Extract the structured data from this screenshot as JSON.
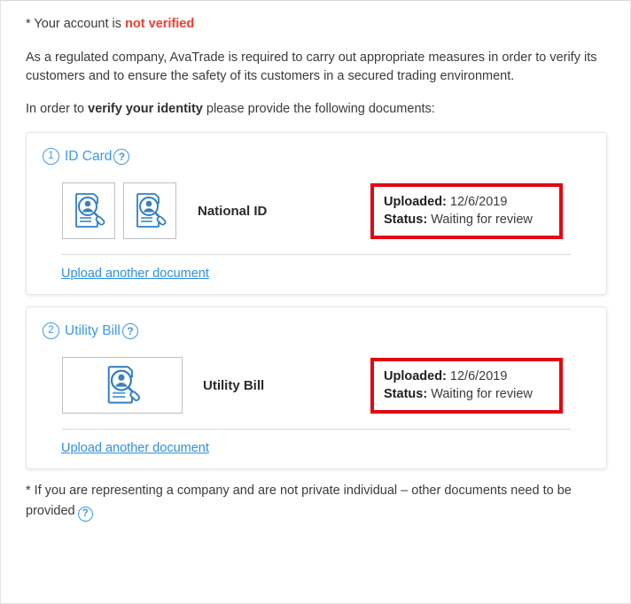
{
  "notice": {
    "prefix": "* Your account is ",
    "status_text": "not verified",
    "status_color": "#ef3e33"
  },
  "description": "As a regulated company, AvaTrade is required to carry out appropriate measures in order to verify its customers and to ensure the safety of its customers in a secured trading environment.",
  "instruction": {
    "before": "In order to ",
    "emphasis": "verify your identity",
    "after": " please provide the following documents:"
  },
  "sections": [
    {
      "number": "1",
      "title": "ID Card",
      "help_icon": "question-mark-icon",
      "help_label": "?",
      "document_label": "National ID",
      "thumbnail_count": 2,
      "thumbnail_style": "square",
      "thumbnail_icon": "id-document-magnifier-icon",
      "status": {
        "uploaded_key": "Uploaded:",
        "uploaded_value": "12/6/2019",
        "status_key": "Status:",
        "status_value": "Waiting for review",
        "highlight_color": "#e30613"
      },
      "upload_link": "Upload another document"
    },
    {
      "number": "2",
      "title": "Utility Bill",
      "help_icon": "question-mark-icon",
      "help_label": "?",
      "document_label": "Utility Bill",
      "thumbnail_count": 1,
      "thumbnail_style": "wide",
      "thumbnail_icon": "id-document-magnifier-icon",
      "status": {
        "uploaded_key": "Uploaded:",
        "uploaded_value": "12/6/2019",
        "status_key": "Status:",
        "status_value": "Waiting for review",
        "highlight_color": "#e30613"
      },
      "upload_link": "Upload another document"
    }
  ],
  "footer": {
    "text": "* If you are representing a company and are not private individual – other documents need to be provided",
    "help_icon": "question-mark-icon",
    "help_label": "?"
  },
  "colors": {
    "link_blue": "#2f8fe0",
    "title_blue": "#3a9ae8",
    "alert_red": "#ef3e33",
    "annotation_red": "#e30613"
  }
}
